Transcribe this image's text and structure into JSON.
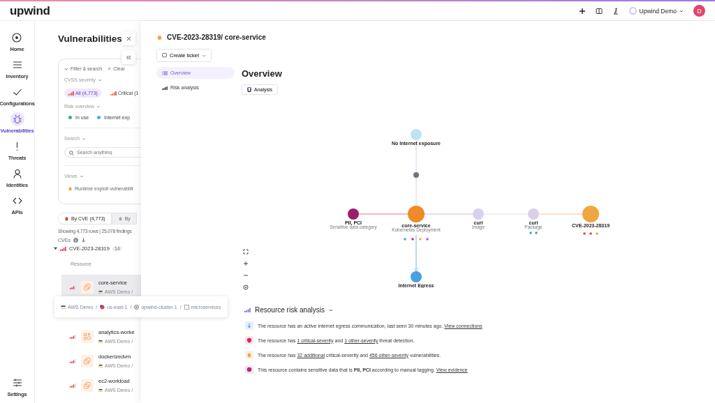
{
  "brand": {
    "logo": "upwind"
  },
  "topbar": {
    "account": "Upwind Demo",
    "avatar": "D"
  },
  "nav": [
    {
      "label": "Home",
      "kind": "home",
      "selected": false
    },
    {
      "label": "Inventory",
      "kind": "list",
      "selected": false
    },
    {
      "label": "Configurations",
      "kind": "check",
      "selected": false
    },
    {
      "label": "Vulnerabilities",
      "kind": "bug",
      "selected": true
    },
    {
      "label": "Threats",
      "kind": "alert",
      "selected": false
    },
    {
      "label": "Identities",
      "kind": "user",
      "selected": false
    },
    {
      "label": "APIs",
      "kind": "code",
      "selected": false
    }
  ],
  "nav_bottom": {
    "label": "Settings"
  },
  "list_panel": {
    "title": "Vulnerabilities",
    "filter_toggle": "Filter & search",
    "clear": "Clear",
    "cvss_label": "CVSS severity",
    "severity_chips": [
      {
        "label": "All (4,773)",
        "selected": true
      },
      {
        "label": "Critical (1",
        "selected": false
      }
    ],
    "risk_label": "Risk overview",
    "risk_chips": [
      {
        "label": "In use",
        "color": "#3db26a"
      },
      {
        "label": "Internet exp",
        "color": "#5aa6e0"
      }
    ],
    "search_label": "Search",
    "search": {
      "placeholder": "Search anything"
    },
    "views_label": "Views",
    "view": "Runtime exploit vulnerabilit",
    "view_tabs": [
      {
        "label": "By CVE (4,773)",
        "selected": true
      },
      {
        "label": "By",
        "selected": false
      }
    ],
    "summary": "Showing 4,773 rows | 25,078 findings",
    "column": "CVEs",
    "group_row": {
      "name": "CVE-2023-28319",
      "badge": "14"
    },
    "resource_header": "Resource",
    "rows": [
      {
        "name": "core-service",
        "account": "AWS Demo /",
        "kind": "deployment",
        "selected": true
      },
      {
        "name": "analytics-worke",
        "account": "AWS Demo /",
        "kind": "workload",
        "selected": false
      },
      {
        "name": "dockerizedvm",
        "account": "AWS Demo /",
        "kind": "deployment",
        "selected": false
      },
      {
        "name": "ec2-workload",
        "account": "AWS Demo /",
        "kind": "deployment",
        "selected": false
      }
    ]
  },
  "tooltip": {
    "separator": "/",
    "parts": [
      {
        "label": "AWS Demo",
        "kind": "aws"
      },
      {
        "label": "us-east-1",
        "kind": "flag"
      },
      {
        "label": "upwind-cluster-1",
        "kind": "cluster"
      },
      {
        "label": "microservices",
        "kind": "namespace"
      }
    ]
  },
  "drawer": {
    "title": "CVE-2023-28319/ core-service",
    "create_ticket": "Create ticket",
    "subnav": [
      {
        "label": "Overview",
        "selected": true
      },
      {
        "label": "Risk analysis",
        "selected": false
      }
    ],
    "heading": "Overview",
    "analysis_button": "Analysis",
    "nodes": [
      {
        "label": "No Internet exposure",
        "kind": "globe"
      },
      {
        "kind": "hub"
      },
      {
        "label": "PII, PCI",
        "sublabel": "Sensitive data category",
        "kind": "data"
      },
      {
        "label": "core-service",
        "sublabel": "Kubernetes Deployment",
        "kind": "deployment"
      },
      {
        "label": "curl",
        "sublabel": "Image",
        "kind": "image"
      },
      {
        "label": "curl",
        "sublabel": "Package",
        "kind": "package"
      },
      {
        "label": "CVE-2023-28319",
        "kind": "cve"
      },
      {
        "label": "Internet Egress",
        "kind": "egress"
      }
    ],
    "section_title": "Resource risk analysis",
    "findings": [
      {
        "kind": "egress",
        "segments": [
          {
            "kind": "text",
            "text": "The resource has an active internet egress communication, last seen 30 minutes ago."
          },
          {
            "kind": "link",
            "text": "View connections"
          }
        ]
      },
      {
        "kind": "threat",
        "segments": [
          {
            "kind": "text",
            "text": "The resource has"
          },
          {
            "kind": "link",
            "text": "1 critical-severity"
          },
          {
            "kind": "text",
            "text": "and"
          },
          {
            "kind": "link",
            "text": "1 other-severity"
          },
          {
            "kind": "text",
            "text": "threat detection."
          }
        ]
      },
      {
        "kind": "vuln",
        "segments": [
          {
            "kind": "text",
            "text": "The resource has"
          },
          {
            "kind": "link",
            "text": "32 additional"
          },
          {
            "kind": "text",
            "text": "critical-severity and"
          },
          {
            "kind": "link",
            "text": "456 other-severity"
          },
          {
            "kind": "text",
            "text": "vulnerabilities."
          }
        ]
      },
      {
        "kind": "data",
        "segments": [
          {
            "kind": "text",
            "text": "This resource contains sensitive data that is"
          },
          {
            "kind": "bold",
            "text": "PII, PCI"
          },
          {
            "kind": "text",
            "text": "according to manual tagging."
          },
          {
            "kind": "link",
            "text": "View evidence"
          }
        ]
      }
    ]
  }
}
